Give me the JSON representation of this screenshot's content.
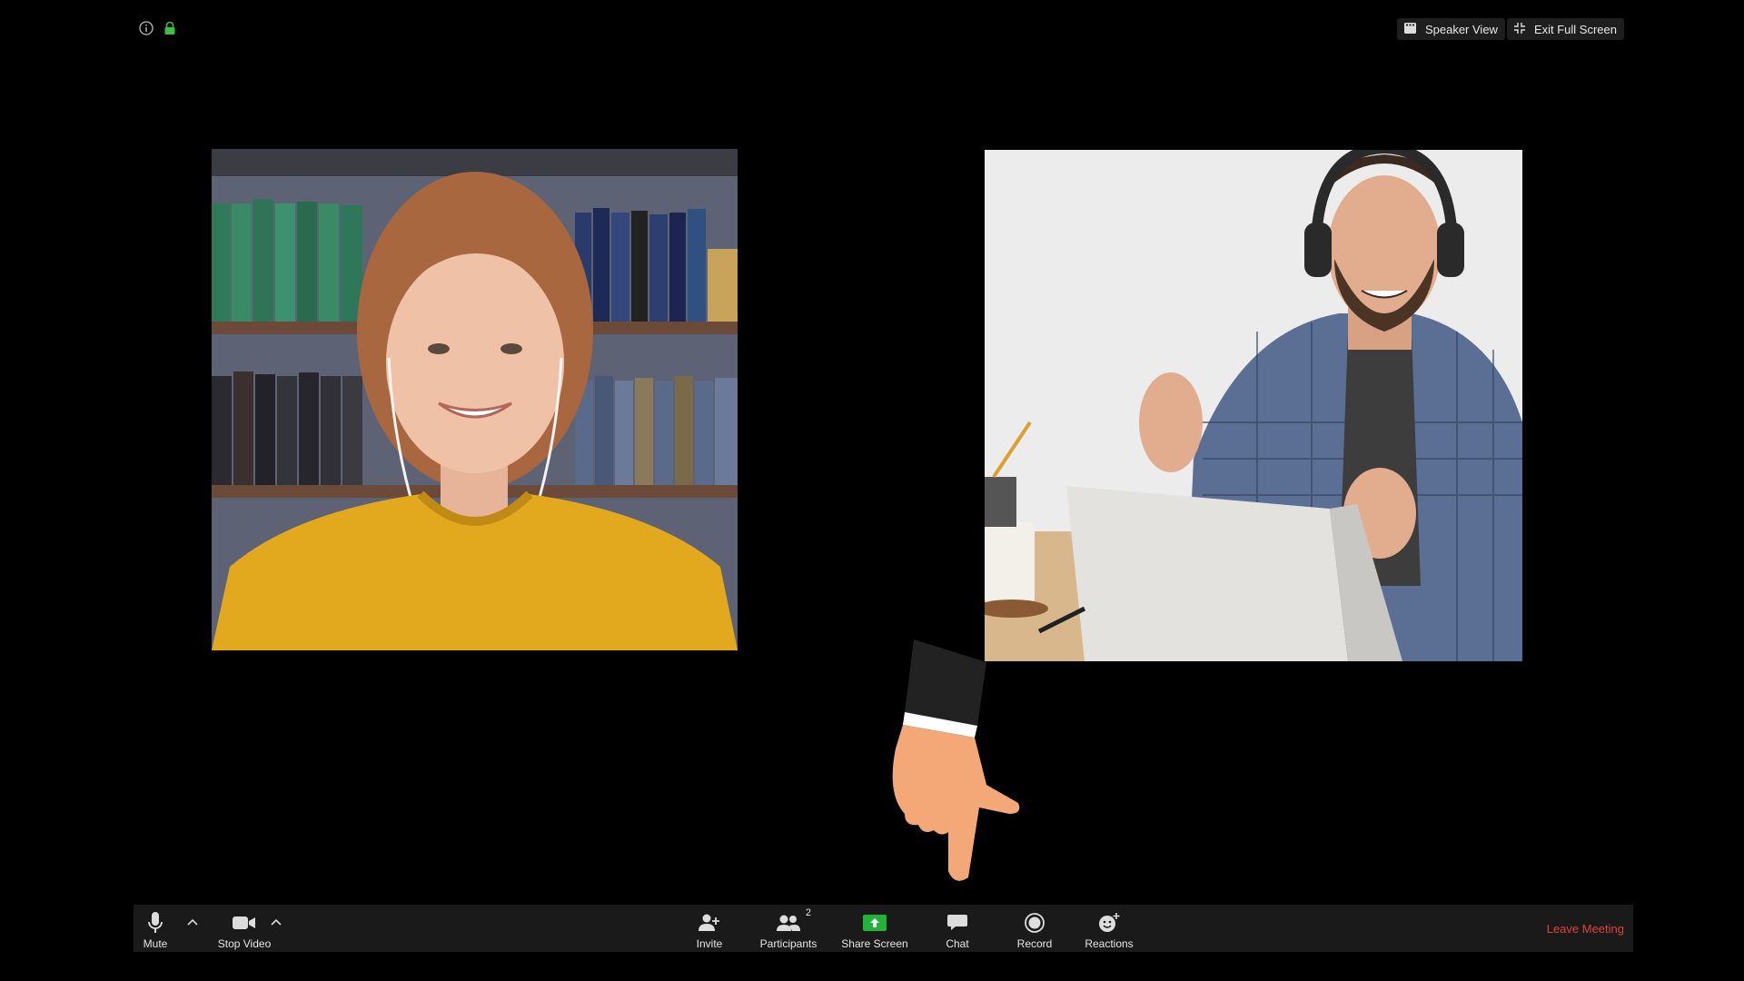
{
  "top_right": {
    "speaker_view": "Speaker View",
    "exit_full_screen": "Exit Full Screen"
  },
  "participants": [
    {
      "tile": "participant-1"
    },
    {
      "tile": "participant-2"
    }
  ],
  "toolbar": {
    "mute": "Mute",
    "stop_video": "Stop Video",
    "invite": "Invite",
    "participants": "Participants",
    "participants_count": "2",
    "share_screen": "Share Screen",
    "chat": "Chat",
    "record": "Record",
    "reactions": "Reactions",
    "leave_meeting": "Leave Meeting"
  },
  "colors": {
    "share_green": "#23b33a",
    "leave_red": "#e0433a",
    "lock_green": "#3fbf3f",
    "toolbar_bg": "#1a1a1a"
  },
  "icons": [
    "info-icon",
    "lock-icon",
    "speaker-view-icon",
    "exit-fullscreen-icon",
    "microphone-icon",
    "video-camera-icon",
    "invite-icon",
    "participants-icon",
    "share-screen-icon",
    "chat-icon",
    "record-icon",
    "reactions-icon",
    "chevron-up-icon"
  ]
}
